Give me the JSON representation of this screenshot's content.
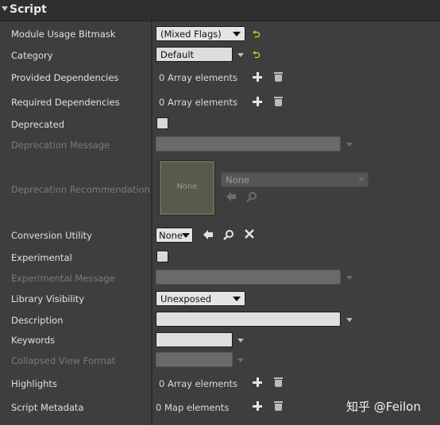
{
  "section": {
    "title": "Script"
  },
  "rows": {
    "module_usage_bitmask": {
      "label": "Module Usage Bitmask",
      "value": "(Mixed Flags)"
    },
    "category": {
      "label": "Category",
      "value": "Default"
    },
    "provided_dependencies": {
      "label": "Provided Dependencies",
      "value": "0 Array elements"
    },
    "required_dependencies": {
      "label": "Required Dependencies",
      "value": "0 Array elements"
    },
    "deprecated": {
      "label": "Deprecated",
      "checked": false
    },
    "deprecation_message": {
      "label": "Deprecation Message",
      "value": ""
    },
    "deprecation_recommendation": {
      "label": "Deprecation Recommendation",
      "thumbnail_text": "None",
      "asset_value": "None"
    },
    "conversion_utility": {
      "label": "Conversion Utility",
      "value": "None"
    },
    "experimental": {
      "label": "Experimental",
      "checked": false
    },
    "experimental_message": {
      "label": "Experimental Message",
      "value": ""
    },
    "library_visibility": {
      "label": "Library Visibility",
      "value": "Unexposed"
    },
    "description": {
      "label": "Description",
      "value": ""
    },
    "keywords": {
      "label": "Keywords",
      "value": ""
    },
    "collapsed_view_format": {
      "label": "Collapsed View Format",
      "value": ""
    },
    "highlights": {
      "label": "Highlights",
      "value": "0 Array elements"
    },
    "script_metadata": {
      "label": "Script Metadata",
      "value": "0 Map elements"
    }
  },
  "icons": {
    "reset": "reset-to-default-icon",
    "add": "plus-icon",
    "delete": "trash-icon",
    "browse": "arrow-left-icon",
    "find": "search-icon",
    "clear": "close-icon"
  },
  "watermark": "知乎 @Feilon",
  "colors": {
    "reset_accent": "#d9c51c",
    "background": "#3e3e3e",
    "header": "#2f2f2f"
  }
}
